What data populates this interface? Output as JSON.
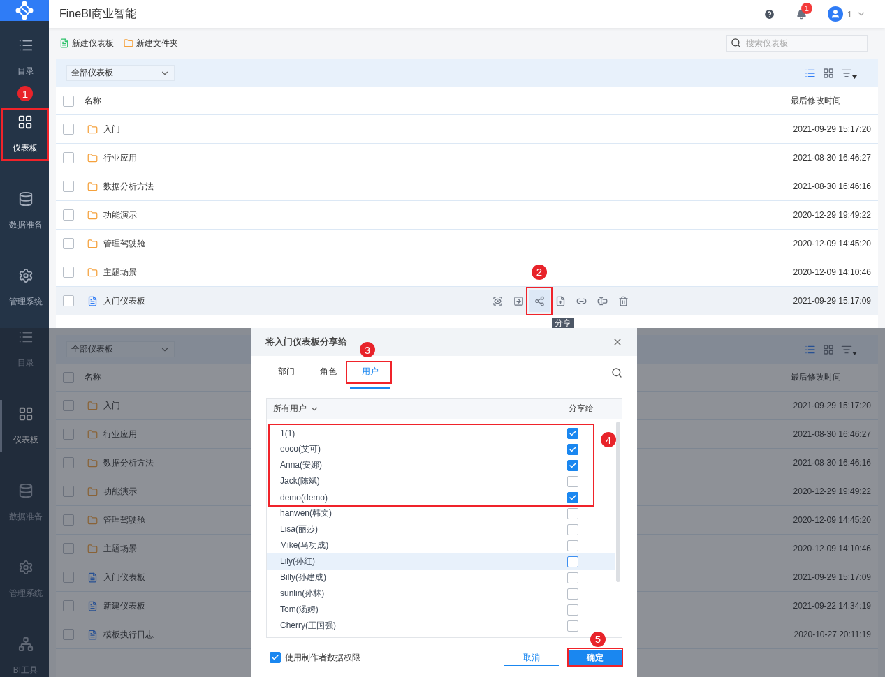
{
  "top_screen": {
    "app_title": "FineBI商业智能",
    "notification_count": "1",
    "user_name": "1",
    "sidebar": [
      {
        "label": "目录",
        "selected": false
      },
      {
        "label": "仪表板",
        "selected": true,
        "annotation": "1"
      },
      {
        "label": "数据准备",
        "selected": false
      },
      {
        "label": "管理系统",
        "selected": false
      }
    ],
    "toolbar": [
      "新建仪表板",
      "新建文件夹"
    ],
    "search": {
      "placeholder": "搜索仪表板"
    },
    "filter": "全部仪表板",
    "view_modes": [
      {
        "kind": "list",
        "selected": true
      },
      {
        "kind": "grid",
        "selected": false
      },
      {
        "kind": "sort",
        "selected": false
      }
    ],
    "columns": [
      "名称",
      "最后修改时间"
    ],
    "select_all_checked": false,
    "rows": [
      {
        "kind": "folder",
        "name": "入门",
        "time": "2021-09-29 15:17:20",
        "checked": false,
        "hovered": false
      },
      {
        "kind": "folder",
        "name": "行业应用",
        "time": "2021-08-30 16:46:27",
        "checked": false,
        "hovered": false
      },
      {
        "kind": "folder",
        "name": "数据分析方法",
        "time": "2021-08-30 16:46:16",
        "checked": false,
        "hovered": false
      },
      {
        "kind": "folder",
        "name": "功能演示",
        "time": "2020-12-29 19:49:22",
        "checked": false,
        "hovered": false
      },
      {
        "kind": "folder",
        "name": "管理驾驶舱",
        "time": "2020-12-09 14:45:20",
        "checked": false,
        "hovered": false
      },
      {
        "kind": "folder",
        "name": "主题场景",
        "time": "2020-12-09 14:10:46",
        "checked": false,
        "hovered": false
      },
      {
        "kind": "dashboard",
        "name": "入门仪表板",
        "time": "2021-09-29 15:17:09",
        "checked": false,
        "hovered": true
      }
    ],
    "row_actions": [
      {
        "kind": "preview",
        "hovered": false
      },
      {
        "kind": "move",
        "hovered": false
      },
      {
        "kind": "share",
        "hovered": true,
        "annotation": "2",
        "tooltip": "分享"
      },
      {
        "kind": "publish",
        "hovered": false
      },
      {
        "kind": "link",
        "hovered": false
      },
      {
        "kind": "rename",
        "hovered": false
      },
      {
        "kind": "delete",
        "hovered": false
      }
    ]
  },
  "bottom_screen": {
    "sidebar": [
      {
        "label": "目录",
        "selected": false
      },
      {
        "label": "仪表板",
        "selected": true
      },
      {
        "label": "数据准备",
        "selected": false
      },
      {
        "label": "管理系统",
        "selected": false
      },
      {
        "label": "BI工具",
        "selected": false
      }
    ],
    "filter": "全部仪表板",
    "view_modes": [
      {
        "kind": "list",
        "selected": true
      },
      {
        "kind": "grid",
        "selected": false
      },
      {
        "kind": "sort",
        "selected": false
      }
    ],
    "columns": [
      "名称",
      "最后修改时间"
    ],
    "select_all_checked": false,
    "rows": [
      {
        "kind": "folder",
        "name": "入门",
        "time": "2021-09-29 15:17:20",
        "checked": false
      },
      {
        "kind": "folder",
        "name": "行业应用",
        "time": "2021-08-30 16:46:27",
        "checked": false
      },
      {
        "kind": "folder",
        "name": "数据分析方法",
        "time": "2021-08-30 16:46:16",
        "checked": false
      },
      {
        "kind": "folder",
        "name": "功能演示",
        "time": "2020-12-29 19:49:22",
        "checked": false
      },
      {
        "kind": "folder",
        "name": "管理驾驶舱",
        "time": "2020-12-09 14:45:20",
        "checked": false
      },
      {
        "kind": "folder",
        "name": "主题场景",
        "time": "2020-12-09 14:10:46",
        "checked": false
      },
      {
        "kind": "dashboard",
        "name": "入门仪表板",
        "time": "2021-09-29 15:17:09",
        "checked": false
      },
      {
        "kind": "dashboard",
        "name": "新建仪表板",
        "time": "2021-09-22 14:34:19",
        "checked": false
      },
      {
        "kind": "dashboard",
        "name": "模板执行日志",
        "time": "2020-10-27 20:11:19",
        "checked": false
      }
    ],
    "dialog": {
      "title": "将入门仪表板分享给",
      "tabs": [
        {
          "label": "部门",
          "selected": false
        },
        {
          "label": "角色",
          "selected": false
        },
        {
          "label": "用户",
          "selected": true,
          "annotation": "3"
        }
      ],
      "list_filter": "所有用户",
      "share_column": "分享给",
      "user_groups": [
        {
          "annotation": "4",
          "users": [
            {
              "name": "1(1)",
              "checked": true,
              "hovered": false
            },
            {
              "name": "eoco(艾可)",
              "checked": true,
              "hovered": false
            },
            {
              "name": "Anna(安娜)",
              "checked": true,
              "hovered": false
            },
            {
              "name": "Jack(陈斌)",
              "checked": false,
              "hovered": false
            },
            {
              "name": "demo(demo)",
              "checked": true,
              "hovered": false
            }
          ]
        },
        {
          "users": [
            {
              "name": "hanwen(韩文)",
              "checked": false,
              "hovered": false
            },
            {
              "name": "Lisa(丽莎)",
              "checked": false,
              "hovered": false
            },
            {
              "name": "Mike(马功成)",
              "checked": false,
              "hovered": false
            },
            {
              "name": "Lily(孙红)",
              "checked": false,
              "hovered": true
            },
            {
              "name": "Billy(孙建成)",
              "checked": false,
              "hovered": false
            },
            {
              "name": "sunlin(孙林)",
              "checked": false,
              "hovered": false
            },
            {
              "name": "Tom(汤姆)",
              "checked": false,
              "hovered": false
            },
            {
              "name": "Cherry(王国强)",
              "checked": false,
              "hovered": false
            }
          ]
        }
      ],
      "use_creator_permission": {
        "label": "使用制作者数据权限",
        "checked": true
      },
      "cancel_button": "取消",
      "confirm_button": {
        "label": "确定",
        "annotation": "5"
      }
    }
  }
}
